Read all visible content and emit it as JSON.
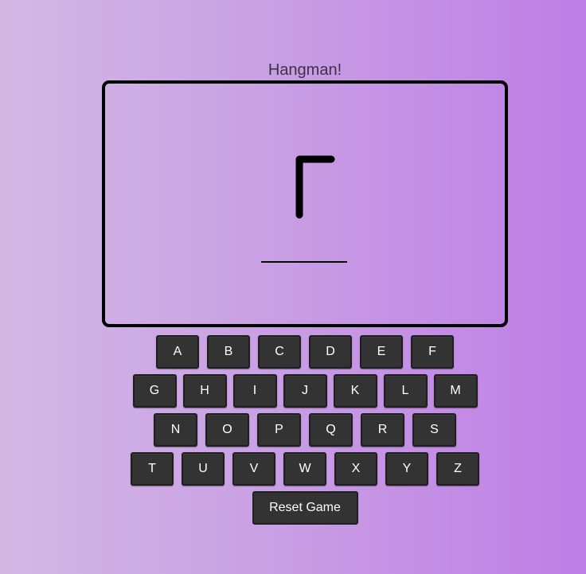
{
  "title": "Hangman!",
  "keyboard": {
    "rows": [
      [
        "A",
        "B",
        "C",
        "D",
        "E",
        "F"
      ],
      [
        "G",
        "H",
        "I",
        "J",
        "K",
        "L",
        "M"
      ],
      [
        "N",
        "O",
        "P",
        "Q",
        "R",
        "S"
      ],
      [
        "T",
        "U",
        "V",
        "W",
        "X",
        "Y",
        "Z"
      ]
    ]
  },
  "reset_label": "Reset Game",
  "colors": {
    "key_bg": "#333333",
    "key_text": "#ffffff",
    "board_border": "#000000"
  }
}
